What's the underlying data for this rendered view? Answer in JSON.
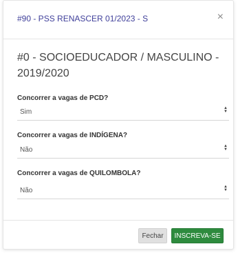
{
  "modal": {
    "title": "#90 - PSS RENASCER 01/2023 - S",
    "close_symbol": "×",
    "heading": "#0 - SOCIOEDUCADOR / MASCULINO - 2019/2020"
  },
  "fields": [
    {
      "label": "Concorrer a vagas de PCD?",
      "value": "Sim"
    },
    {
      "label": "Concorrer a vagas de INDÍGENA?",
      "value": "Não"
    },
    {
      "label": "Concorrer a vagas de QUILOMBOLA?",
      "value": "Não"
    }
  ],
  "footer": {
    "close_label": "Fechar",
    "submit_label": "INSCREVA-SE"
  },
  "colors": {
    "title": "#3f3f9a",
    "primary_button": "#2e8b3e"
  }
}
